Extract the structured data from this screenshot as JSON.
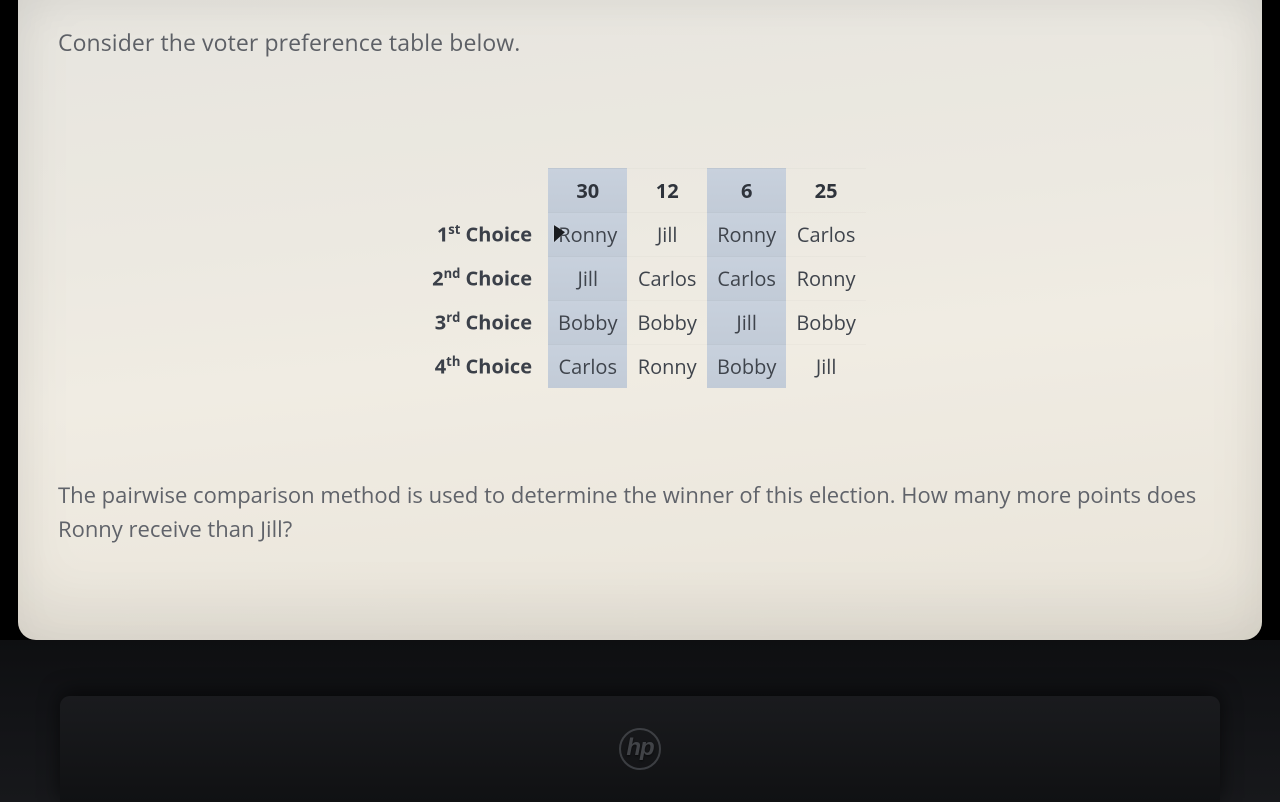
{
  "intro": "Consider the voter preference table below.",
  "table": {
    "counts": [
      "30",
      "12",
      "6",
      "25"
    ],
    "rows": [
      {
        "label_num": "1",
        "label_ord": "st",
        "label_word": " Choice",
        "cells": [
          "Ronny",
          "Jill",
          "Ronny",
          "Carlos"
        ]
      },
      {
        "label_num": "2",
        "label_ord": "nd",
        "label_word": " Choice",
        "cells": [
          "Jill",
          "Carlos",
          "Carlos",
          "Ronny"
        ]
      },
      {
        "label_num": "3",
        "label_ord": "rd",
        "label_word": " Choice",
        "cells": [
          "Bobby",
          "Bobby",
          "Jill",
          "Bobby"
        ]
      },
      {
        "label_num": "4",
        "label_ord": "th",
        "label_word": " Choice",
        "cells": [
          "Carlos",
          "Ronny",
          "Bobby",
          "Jill"
        ]
      }
    ]
  },
  "question": "The pairwise comparison method is used to determine the winner of this election. How many more points does Ronny receive than Jill?",
  "logo": "hp"
}
